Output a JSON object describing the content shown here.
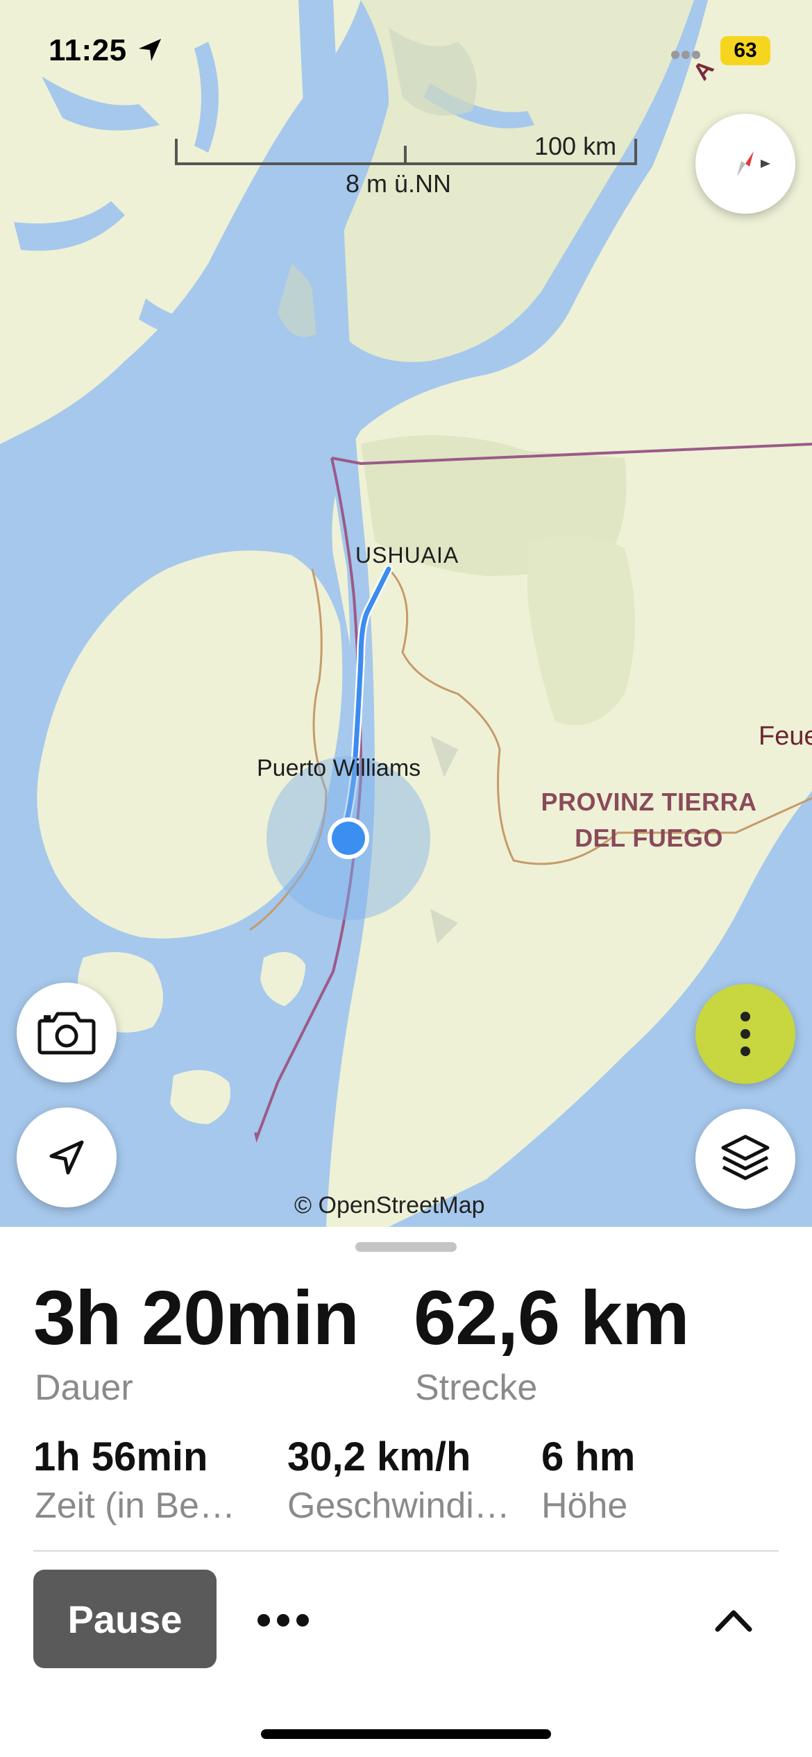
{
  "status_bar": {
    "time": "11:25",
    "battery": "63"
  },
  "map": {
    "scale_label": "100 km",
    "elevation_label": "8 m ü.NN",
    "attribution": "© OpenStreetMap",
    "labels": {
      "ushuaia": "USHUAIA",
      "puerto_williams": "Puerto Williams",
      "province_line1": "PROVINZ TIERRA",
      "province_line2": "DEL FUEGO",
      "feue": "Feue",
      "road_marker": "A"
    },
    "colors": {
      "water": "#a6c8ec",
      "land": "#eef1d6",
      "border": "#9b5a88",
      "route": "#3c8cf0",
      "location": "#3a8ff0"
    },
    "icons": {
      "compass": "compass-icon",
      "camera": "camera-icon",
      "locate": "location-arrow-icon",
      "more": "more-vertical-icon",
      "layers": "layers-icon"
    }
  },
  "stats": {
    "duration_value": "3h 20min",
    "duration_label": "Dauer",
    "distance_value": "62,6 km",
    "distance_label": "Strecke",
    "moving_time_value": "1h 56min",
    "moving_time_label": "Zeit (in Be…",
    "speed_value": "30,2 km/h",
    "speed_label": "Geschwindi…",
    "elevation_value": "6 hm",
    "elevation_label": "Höhe"
  },
  "controls": {
    "pause_label": "Pause",
    "more_label": "•••"
  }
}
